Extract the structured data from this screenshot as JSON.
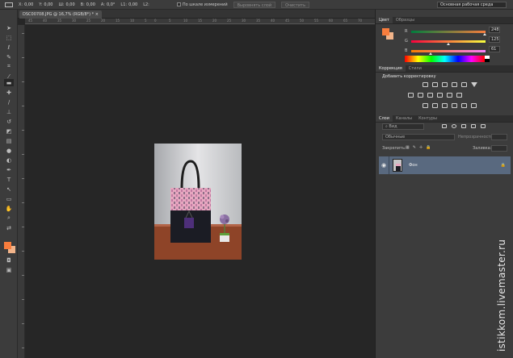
{
  "options_bar": {
    "x_label": "X:",
    "x_value": "0,00",
    "y_label": "Y:",
    "y_value": "0,00",
    "w_label": "Ш:",
    "w_value": "0,00",
    "h_label": "В:",
    "h_value": "0,00",
    "a_label": "A:",
    "a_value": "0,0°",
    "l1_label": "L1:",
    "l1_value": "0,00",
    "l2_label": "L2:",
    "scale_checkbox_label": "По шкале измерений",
    "straighten_button": "Выровнять слой",
    "clear_button": "Очистить",
    "workspace": "Основная рабочая среда"
  },
  "document": {
    "tab_title": "DSC00708.JPG @ 16,7% (RGB/8*) *"
  },
  "ruler": {
    "ticks": [
      "45",
      "40",
      "35",
      "30",
      "25",
      "20",
      "15",
      "10",
      "5",
      "0",
      "5",
      "10",
      "15",
      "20",
      "25",
      "30",
      "35",
      "40",
      "45",
      "50",
      "55",
      "60",
      "65",
      "70"
    ]
  },
  "color_panel": {
    "tabs": [
      "Цвет",
      "Образцы"
    ],
    "r_label": "R",
    "r_value": "248",
    "g_label": "G",
    "g_value": "125",
    "b_label": "B",
    "b_value": "61",
    "foreground": "#f87d3d",
    "background": "#f2b48a"
  },
  "adjustments_panel": {
    "tabs": [
      "Коррекция",
      "Стили"
    ],
    "title": "Добавить корректировку"
  },
  "layers_panel": {
    "tabs": [
      "Слои",
      "Каналы",
      "Контуры"
    ],
    "filter_kind": "Вид",
    "blend_mode": "Обычные",
    "opacity_label": "Непрозрачность:",
    "lock_label": "Закрепить:",
    "fill_label": "Заливка:",
    "layer_name": "Фон"
  },
  "watermark": "istikkom.livemaster.ru",
  "colors": {
    "layer_selected": "#59697f",
    "canvas": "#262626",
    "panel": "#3c3c3c"
  }
}
